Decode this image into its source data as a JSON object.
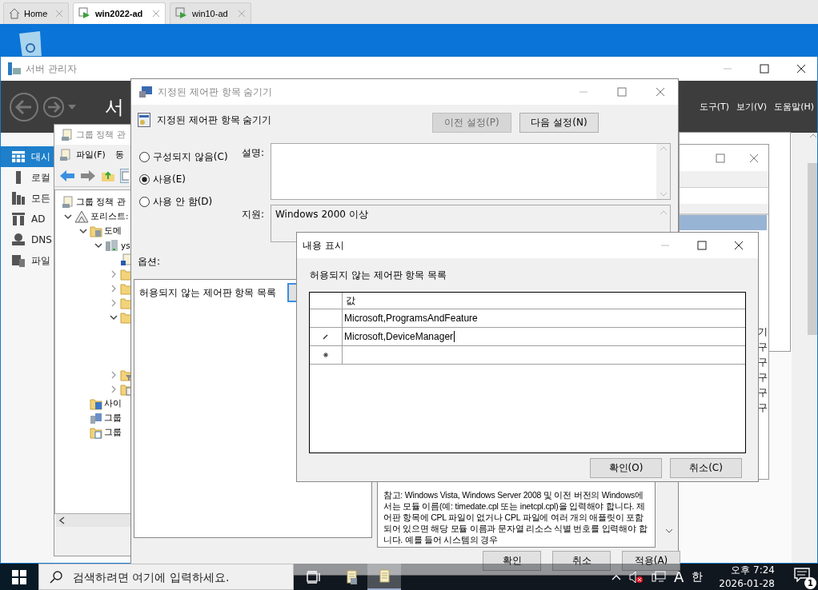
{
  "vm_tabs": [
    {
      "label": "Home",
      "kind": "home",
      "selected": false
    },
    {
      "label": "win2022-ad",
      "kind": "vm",
      "selected": true
    },
    {
      "label": "win10-ad",
      "kind": "vm",
      "selected": false
    }
  ],
  "server_manager": {
    "title": "서버 관리자",
    "heading": "서",
    "menu": [
      "도구(T)",
      "보기(V)",
      "도움말(H)"
    ],
    "nav": [
      {
        "label": "대시",
        "kind": "dashboard",
        "selected": true
      },
      {
        "label": "로컬",
        "kind": "local",
        "selected": false
      },
      {
        "label": "모든",
        "kind": "all",
        "selected": false
      },
      {
        "label": "AD",
        "kind": "ad",
        "selected": false
      },
      {
        "label": "DNS",
        "kind": "dns",
        "selected": false
      },
      {
        "label": "파일",
        "kind": "file",
        "selected": false
      }
    ]
  },
  "background_window": {
    "rows": [
      {
        "selected": true
      },
      {
        "text": "기",
        "selected": false
      },
      {
        "text": "구",
        "selected": false
      },
      {
        "text": "구",
        "selected": false
      },
      {
        "text": "구",
        "selected": false
      },
      {
        "text": "구",
        "selected": false
      },
      {
        "text": "구",
        "selected": false
      }
    ]
  },
  "gpm_window": {
    "title": "그룹 정책 관",
    "active": false,
    "menu": [
      "파일(F)",
      "동"
    ],
    "tree": [
      {
        "label": "그룹 정책 관",
        "kind": "console",
        "children": [
          {
            "label": "포리스트:",
            "kind": "forest",
            "expanded": true,
            "children": [
              {
                "label": "도메",
                "kind": "domains",
                "expanded": true,
                "children": [
                  {
                    "label": "ys",
                    "kind": "domain",
                    "expanded": true,
                    "children": [
                      {
                        "kind": "link"
                      },
                      {
                        "kind": "folder",
                        "expanded": false
                      },
                      {
                        "kind": "folder",
                        "expanded": false
                      },
                      {
                        "kind": "folder",
                        "expanded": false
                      },
                      {
                        "kind": "folder",
                        "expanded": true
                      },
                      {
                        "kind": "filter",
                        "expanded": false
                      },
                      {
                        "kind": "starter",
                        "expanded": false
                      }
                    ]
                  }
                ]
              },
              {
                "label": "사이",
                "kind": "sites"
              },
              {
                "label": "그룹",
                "kind": "modeling"
              },
              {
                "label": "그룹",
                "kind": "results"
              }
            ]
          }
        ]
      }
    ]
  },
  "policy_window": {
    "title": "지정된 제어판 항목 숨기기",
    "active": false,
    "heading": "지정된 제어판 항목 숨기기",
    "nav_buttons": [
      {
        "label": "이전 설정(P)",
        "disabled": true
      },
      {
        "label": "다음 설정(N)",
        "disabled": false
      }
    ],
    "radios": [
      {
        "label": "구성되지 않음(C)",
        "selected": false
      },
      {
        "label": "사용(E)",
        "selected": true
      },
      {
        "label": "사용 안 함(D)",
        "selected": false
      }
    ],
    "description_label": "설명:",
    "supported_label": "지원:",
    "supported_value": "Windows 2000 이상",
    "options_label": "옵션:",
    "option_text": "허용되지 않는 제어판 항목 목록",
    "help_text": "참고: Windows Vista, Windows Server 2008 및 이전 버전의 Windows에서는 모듈 이름(예: timedate.cpl 또는 inetcpl.cpl)을 입력해야 합니다. 제어판 항목에 CPL 파일이 없거나 CPL 파일에 여러 개의 애플릿이 포함되어 있으면 해당 모듈 이름과 문자열 리소스 식별 번호를 입력해야 합니다. 예를 들어 시스템의 경우",
    "buttons": [
      "확인",
      "취소",
      "적용(A)"
    ]
  },
  "content_dialog": {
    "title": "내용 표시",
    "active": true,
    "label": "허용되지 않는 제어판 항목 목록",
    "column_header": "값",
    "rows": [
      {
        "kind": "value",
        "value": "Microsoft,ProgramsAndFeature"
      },
      {
        "kind": "editing",
        "value": "Microsoft,DeviceManager"
      },
      {
        "kind": "new"
      }
    ],
    "buttons": [
      "확인(O)",
      "취소(C)"
    ]
  },
  "taskbar": {
    "search_placeholder": "검색하려면 여기에 입력하세요.",
    "apps": [
      {
        "kind": "scroll-server",
        "selected": false
      },
      {
        "kind": "scroll",
        "selected": true
      }
    ],
    "ime_mode": "A",
    "ime_language": "한",
    "time": "오후 7:24",
    "date": "2026-01-28",
    "notifications": "1"
  }
}
